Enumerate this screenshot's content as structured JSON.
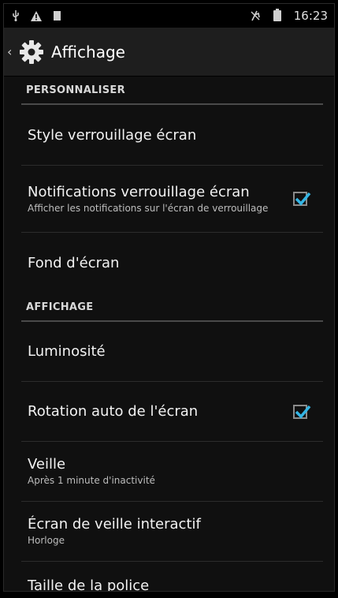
{
  "status_bar": {
    "time": "16:23",
    "icons": [
      "usb-icon",
      "warning-icon",
      "notification-square-icon",
      "mute-icon",
      "battery-icon"
    ]
  },
  "action_bar": {
    "title": "Affichage",
    "icon": "gear-icon"
  },
  "sections": [
    {
      "header": "PERSONNALISER",
      "items": [
        {
          "title": "Style verrouillage écran"
        },
        {
          "title": "Notifications verrouillage écran",
          "summary": "Afficher les notifications sur l'écran de verrouillage",
          "checked": true
        },
        {
          "title": "Fond d'écran"
        }
      ]
    },
    {
      "header": "AFFICHAGE",
      "items": [
        {
          "title": "Luminosité"
        },
        {
          "title": "Rotation auto de l'écran",
          "checked": true
        },
        {
          "title": "Veille",
          "summary": "Après 1 minute d'inactivité"
        },
        {
          "title": "Écran de veille interactif",
          "summary": "Horloge"
        },
        {
          "title": "Taille de la police"
        }
      ]
    }
  ],
  "colors": {
    "accent": "#33b5e5",
    "background": "#101010",
    "action_bar": "#1e1e1e"
  }
}
